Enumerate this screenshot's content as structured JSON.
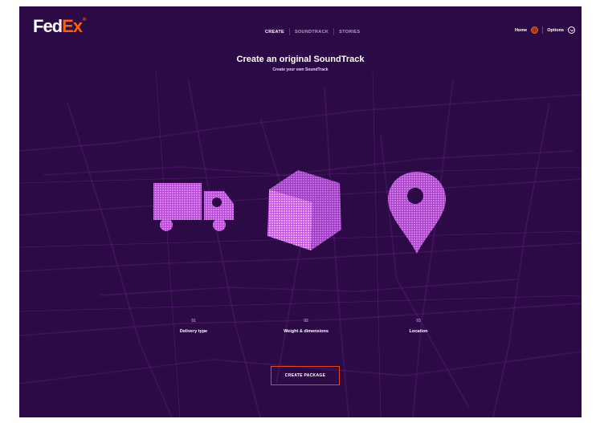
{
  "brand": {
    "logo_fed": "Fed",
    "logo_ex": "Ex",
    "logo_mark": "®"
  },
  "nav": {
    "tabs": [
      {
        "label": "CREATE",
        "active": true
      },
      {
        "label": "SOUNDTRACK",
        "active": false
      },
      {
        "label": "STORIES",
        "active": false
      }
    ]
  },
  "topright": {
    "home": "Home",
    "options": "Options",
    "home_icon": "globe-icon",
    "options_icon": "chevron-down-icon"
  },
  "hero": {
    "title": "Create an original SoundTrack",
    "subtitle": "Create your own SoundTrack"
  },
  "steps": [
    {
      "num": "01",
      "label": "Delivery type",
      "icon": "truck-icon"
    },
    {
      "num": "02",
      "label": "Weight & dimensions",
      "icon": "box-icon"
    },
    {
      "num": "03",
      "label": "Location",
      "icon": "location-pin-icon"
    }
  ],
  "cta": {
    "label": "CREATE PACKAGE"
  },
  "colors": {
    "background": "#2c0a45",
    "accent": "#ff6200",
    "particles": "#d86ff0",
    "cta_border": "#e1461e"
  }
}
